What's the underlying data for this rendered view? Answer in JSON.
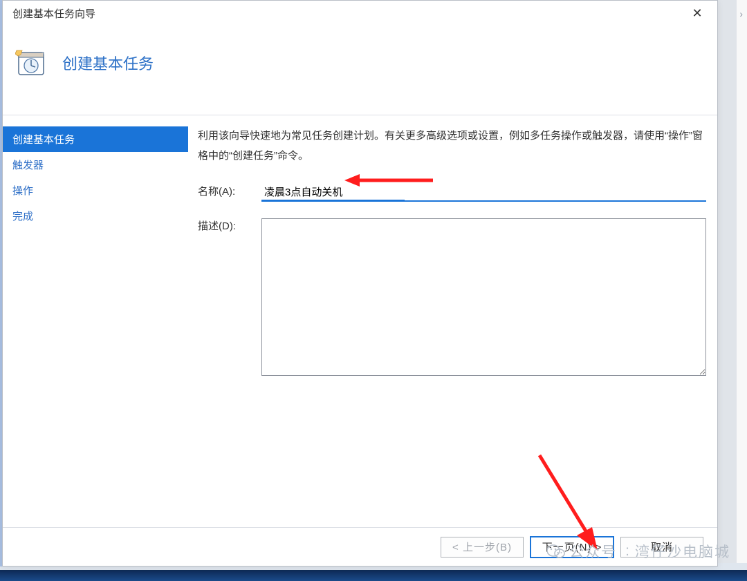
{
  "window": {
    "title": "创建基本任务向导",
    "close_glyph": "✕"
  },
  "header": {
    "title": "创建基本任务"
  },
  "sidebar": {
    "steps": [
      "创建基本任务",
      "触发器",
      "操作",
      "完成"
    ]
  },
  "content": {
    "intro": "利用该向导快速地为常见任务创建计划。有关更多高级选项或设置，例如多任务操作或触发器，请使用“操作”窗格中的“创建任务”命令。",
    "name_label": "名称(A):",
    "name_value": "凌晨3点自动关机",
    "desc_label": "描述(D):",
    "desc_value": ""
  },
  "footer": {
    "back": "< 上一步(B)",
    "next": "下一页(N) >",
    "cancel": "取消"
  },
  "watermark": {
    "prefix": "公众号",
    "suffix": "湾仔沙电脑城"
  },
  "colors": {
    "accent": "#1a74d8",
    "link_blue": "#2e6fc7"
  }
}
